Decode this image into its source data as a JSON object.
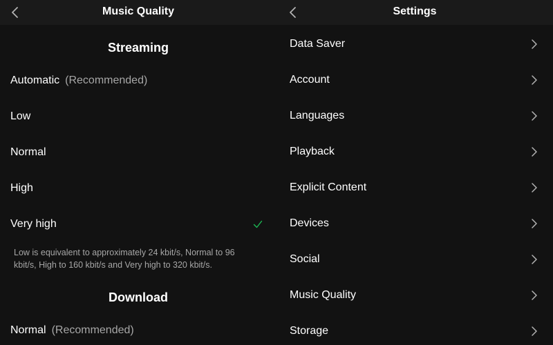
{
  "colors": {
    "background": "#121212",
    "header": "#1a1a1a",
    "text": "#ffffff",
    "secondary_text": "#a7a7a7",
    "accent_check": "#1db954"
  },
  "left_panel": {
    "title": "Music Quality",
    "back_icon": "chevron-left-icon",
    "streaming": {
      "title": "Streaming",
      "options": [
        {
          "label": "Automatic",
          "sublabel": "(Recommended)",
          "selected": false
        },
        {
          "label": "Low",
          "selected": false
        },
        {
          "label": "Normal",
          "selected": false
        },
        {
          "label": "High",
          "selected": false
        },
        {
          "label": "Very high",
          "selected": true
        }
      ],
      "note": "Low is equivalent to approximately 24 kbit/s, Normal to 96 kbit/s, High to 160 kbit/s and Very high to 320 kbit/s."
    },
    "download": {
      "title": "Download",
      "options": [
        {
          "label": "Normal",
          "sublabel": "(Recommended)",
          "selected": false
        }
      ]
    }
  },
  "right_panel": {
    "title": "Settings",
    "back_icon": "chevron-left-icon",
    "items": [
      {
        "label": "Data Saver"
      },
      {
        "label": "Account"
      },
      {
        "label": "Languages"
      },
      {
        "label": "Playback"
      },
      {
        "label": "Explicit Content"
      },
      {
        "label": "Devices"
      },
      {
        "label": "Social"
      },
      {
        "label": "Music Quality"
      },
      {
        "label": "Storage"
      }
    ]
  }
}
